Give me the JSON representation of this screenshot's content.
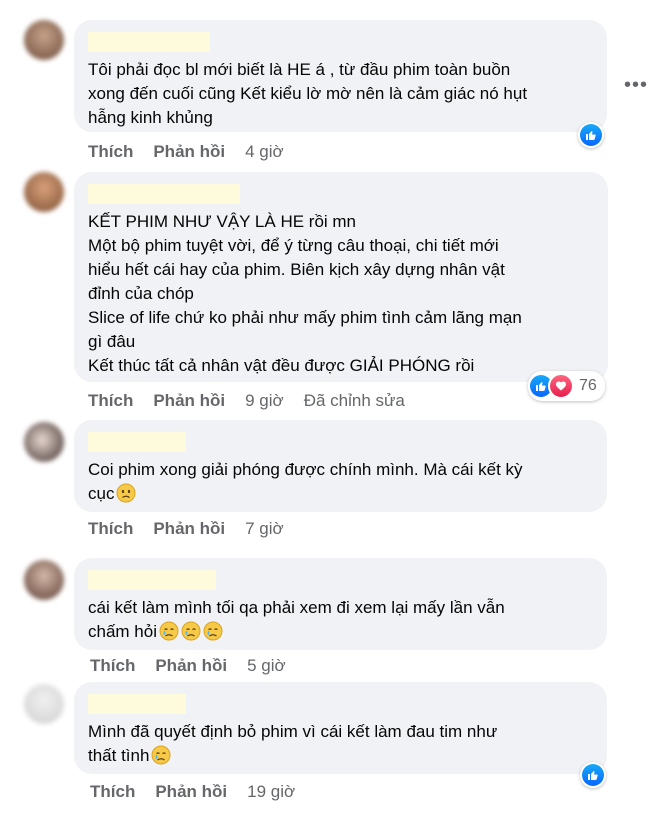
{
  "more_icon": "more-options-icon",
  "comments": [
    {
      "text": "Tôi phải đọc bl mới biết là HE á , từ đầu phim toàn buồn\nxong đến cuối cũng Kết kiểu lờ mờ nên là cảm giác nó hụt\nhẫng kinh khủng",
      "like_label": "Thích",
      "reply_label": "Phản hồi",
      "time": "4 giờ",
      "reactions": [
        "like"
      ]
    },
    {
      "text": "KẾT PHIM NHƯ VẬY LÀ HE rồi mn\nMột bộ phim tuyệt vời, để ý từng câu thoại, chi tiết mới\nhiểu hết cái hay của phim. Biên kịch xây dựng nhân vật\nđỉnh của chóp\nSlice of life chứ ko phải như mấy phim tình cảm lãng mạn\ngì đâu\nKết thúc tất cả nhân vật đều được GIẢI PHÓNG rồi",
      "like_label": "Thích",
      "reply_label": "Phản hồi",
      "time": "9 giờ",
      "edited": "Đã chỉnh sửa",
      "reactions": [
        "like",
        "love"
      ],
      "reaction_count": "76"
    },
    {
      "text": "Coi phim xong giải phóng được chính mình. Mà cái kết kỳ\ncục",
      "emojis": [
        "worried-face-emoji"
      ],
      "like_label": "Thích",
      "reply_label": "Phản hồi",
      "time": "7 giờ"
    },
    {
      "text": "cái kết làm mình tối qa phải xem đi xem lại mấy lần vẫn\nchấm hỏi",
      "emojis": [
        "crying-face-emoji",
        "crying-face-emoji",
        "crying-face-emoji"
      ],
      "like_label": "Thích",
      "reply_label": "Phản hồi",
      "time": "5 giờ"
    },
    {
      "text": "Mình đã quyết định bỏ phim vì cái kết làm đau tim như\nthất tình",
      "emojis": [
        "crying-face-emoji"
      ],
      "like_label": "Thích",
      "reply_label": "Phản hồi",
      "time": "19 giờ",
      "reactions": [
        "like"
      ]
    }
  ]
}
